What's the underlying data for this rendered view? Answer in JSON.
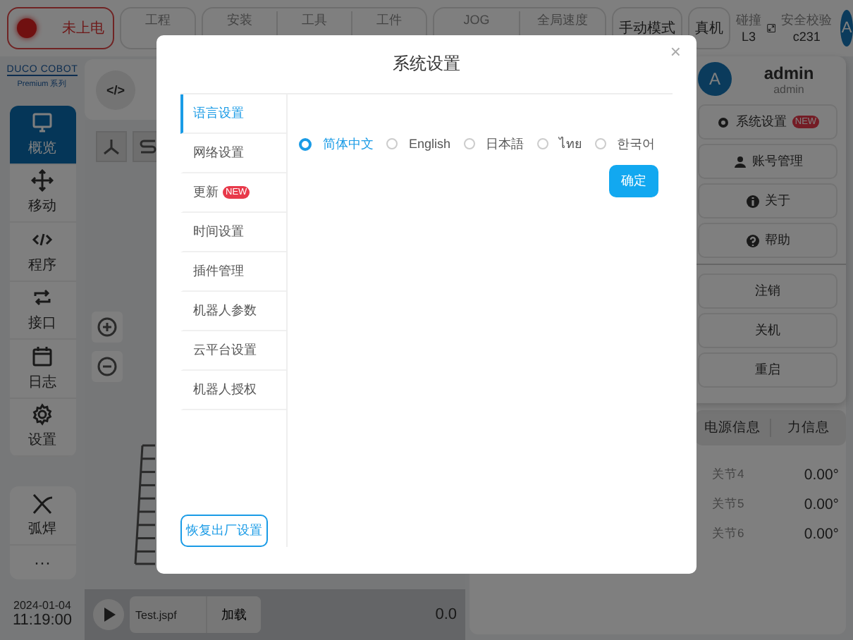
{
  "top_bar": {
    "power_status": "未上电",
    "groups": [
      [
        {
          "label": "工程"
        }
      ],
      [
        {
          "label": "安装"
        },
        {
          "label": "工具"
        },
        {
          "label": "工件"
        }
      ],
      [
        {
          "label": "JOG"
        },
        {
          "label": "全局速度"
        }
      ]
    ],
    "mode": "手动模式",
    "machine": "真机",
    "collision": {
      "label": "碰撞",
      "value": "L3"
    },
    "safety": {
      "label": "安全校验",
      "value": "c231"
    },
    "avatar": "A"
  },
  "sidebar": {
    "logo": "DUCO COBOT",
    "logo_sub": "Premium 系列",
    "nav": [
      {
        "label": "概览",
        "selected": true
      },
      {
        "label": "移动",
        "selected": false
      },
      {
        "label": "程序",
        "selected": false
      },
      {
        "label": "接口",
        "selected": false
      },
      {
        "label": "日志",
        "selected": false
      },
      {
        "label": "设置",
        "selected": false
      }
    ],
    "extra": [
      {
        "label": "弧焊"
      },
      {
        "label": "···"
      }
    ],
    "date": "2024-01-04",
    "time": "11:19:00"
  },
  "center": {
    "code_button": "</>",
    "file": "Test.jspf",
    "load_button": "加载",
    "speed": "0.0"
  },
  "user_menu": {
    "avatar": "A",
    "name": "admin",
    "role": "admin",
    "items": [
      {
        "label": "系统设置",
        "badge": "NEW"
      },
      {
        "label": "账号管理"
      },
      {
        "label": "关于"
      },
      {
        "label": "帮助"
      }
    ],
    "actions": [
      "注销",
      "关机",
      "重启"
    ]
  },
  "info_tabs": [
    "电源信息",
    "力信息"
  ],
  "joints": [
    {
      "name": "关节4",
      "value": "0.00°"
    },
    {
      "name": "关节5",
      "value": "0.00°"
    },
    {
      "name": "关节6",
      "value": "0.00°"
    }
  ],
  "dialog": {
    "title": "系统设置",
    "close": "×",
    "menu": [
      {
        "label": "语言设置",
        "selected": true
      },
      {
        "label": "网络设置",
        "selected": false
      },
      {
        "label": "更新",
        "badge": "NEW",
        "selected": false
      },
      {
        "label": "时间设置",
        "selected": false
      },
      {
        "label": "插件管理",
        "selected": false
      },
      {
        "label": "机器人参数",
        "selected": false
      },
      {
        "label": "云平台设置",
        "selected": false
      },
      {
        "label": "机器人授权",
        "selected": false
      }
    ],
    "languages": [
      {
        "label": "简体中文",
        "selected": true
      },
      {
        "label": "English",
        "selected": false
      },
      {
        "label": "日本語",
        "selected": false
      },
      {
        "label": "ไทย",
        "selected": false
      },
      {
        "label": "한국어",
        "selected": false
      }
    ],
    "confirm": "确定",
    "reset": "恢复出厂设置"
  }
}
